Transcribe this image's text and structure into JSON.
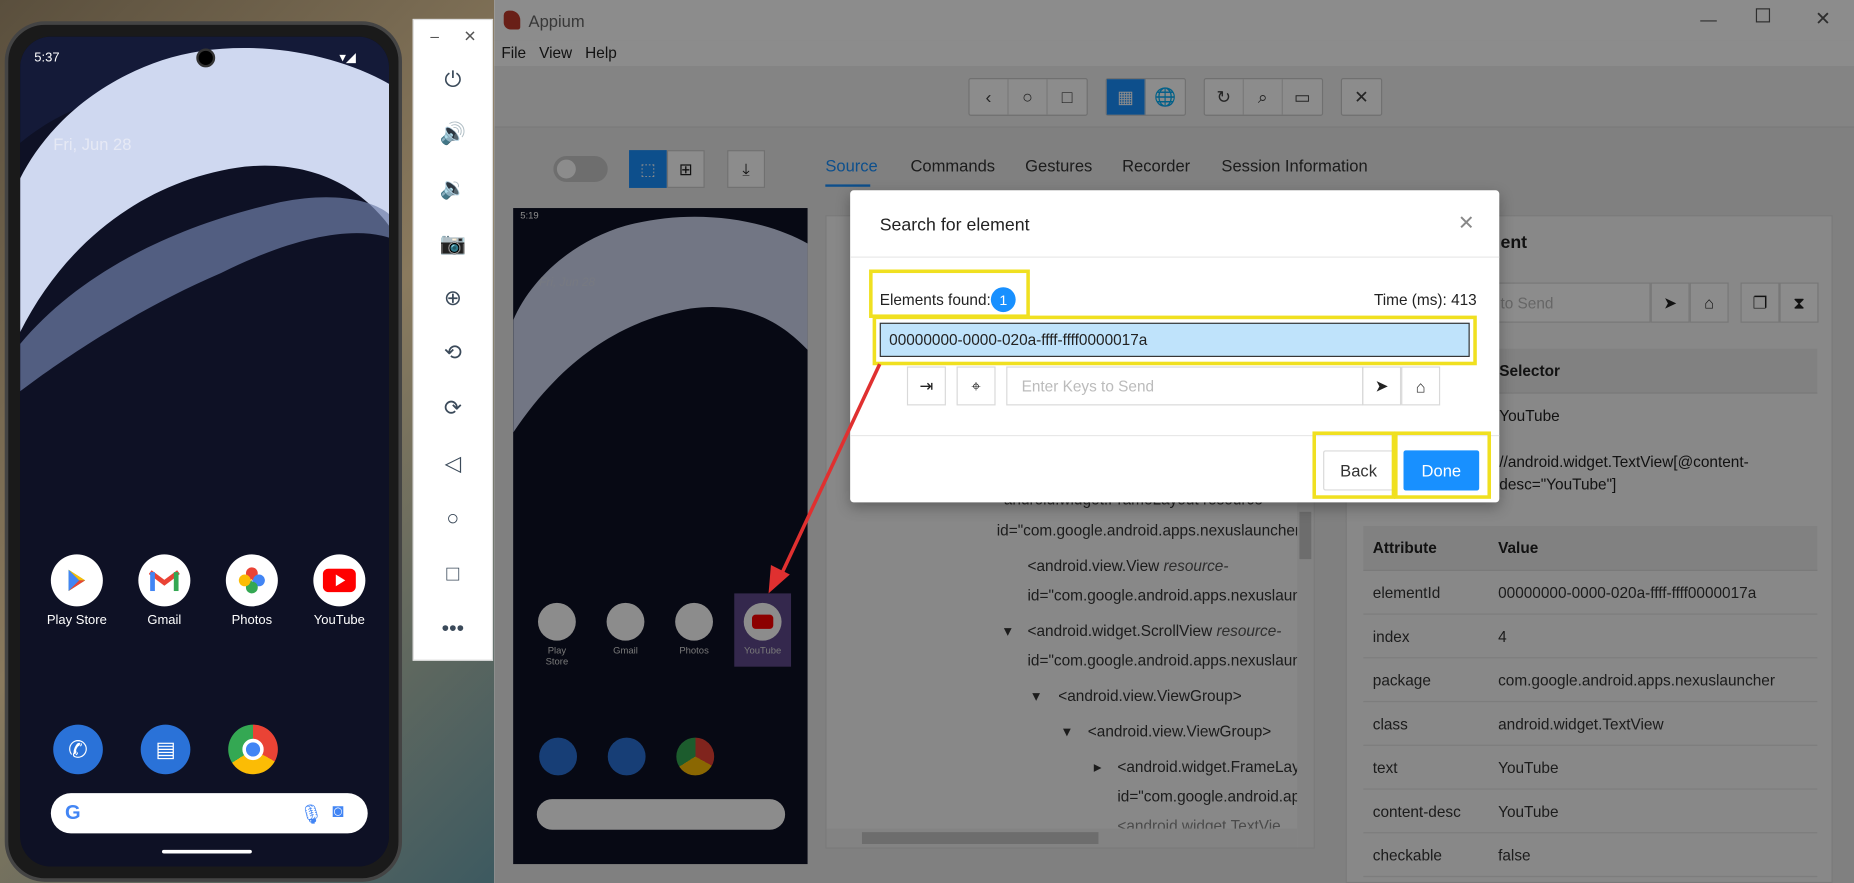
{
  "phone": {
    "time": "5:37",
    "date": "Fri, Jun 28",
    "apps": [
      {
        "label": "Play Store",
        "icon": "play-store-icon"
      },
      {
        "label": "Gmail",
        "icon": "gmail-icon"
      },
      {
        "label": "Photos",
        "icon": "photos-icon"
      },
      {
        "label": "YouTube",
        "icon": "youtube-icon"
      }
    ],
    "dock": [
      "phone-icon",
      "messages-icon",
      "chrome-icon"
    ]
  },
  "emulator_toolbar": {
    "minimize": "–",
    "close": "✕",
    "buttons": [
      "power-icon",
      "volume-up-icon",
      "volume-down-icon",
      "camera-icon",
      "zoom-in-icon",
      "rotate-left-icon",
      "rotate-right-icon",
      "back-icon",
      "home-icon",
      "overview-icon",
      "more-icon"
    ]
  },
  "appium": {
    "title": "Appium",
    "menu": [
      "File",
      "View",
      "Help"
    ],
    "tabs": [
      "Source",
      "Commands",
      "Gestures",
      "Recorder",
      "Session Information"
    ],
    "preview": {
      "time": "5:19",
      "date": "Fri, Jun 28",
      "apps": [
        "Play Store",
        "Gmail",
        "Photos",
        "YouTube"
      ]
    },
    "selected_element_title": "ent",
    "keys_placeholder": "to Send",
    "selector_header": "Selector",
    "selector_values": [
      "YouTube",
      "//android.widget.TextView[@content-desc=\"YouTube\"]"
    ],
    "attr_header": {
      "attribute": "Attribute",
      "value": "Value"
    },
    "attributes": [
      {
        "k": "elementId",
        "v": "00000000-0000-020a-ffff-ffff0000017a"
      },
      {
        "k": "index",
        "v": "4"
      },
      {
        "k": "package",
        "v": "com.google.android.apps.nexuslauncher"
      },
      {
        "k": "class",
        "v": "android.widget.TextView"
      },
      {
        "k": "text",
        "v": "YouTube"
      },
      {
        "k": "content-desc",
        "v": "YouTube"
      },
      {
        "k": "checkable",
        "v": "false"
      }
    ],
    "xml": [
      "android.widget.FrameLayout resource-",
      "id=\"com.google.android.apps.nexuslauncher:",
      "<android.view.View ",
      "resource-",
      "id=\"com.google.android.apps.nexuslaunc",
      "<android.widget.ScrollView ",
      "resource-",
      "id=\"com.google.android.apps.nexuslaunc",
      "<android.view.ViewGroup>",
      "<android.view.ViewGroup>",
      "<android.widget.FrameLayo",
      "id=\"com.google.android.ap",
      "<android.widget.TextVie"
    ]
  },
  "modal": {
    "title": "Search for element",
    "found_label": "Elements found:",
    "found_count": "1",
    "time_label": "Time (ms): 413",
    "element_id": "00000000-0000-020a-ffff-ffff0000017a",
    "keys_placeholder": "Enter Keys to Send",
    "back": "Back",
    "done": "Done"
  },
  "colors": {
    "accent": "#1890ff",
    "highlight": "#f0e020",
    "selected_row": "#bfe3fb",
    "arrow": "#e03030"
  }
}
